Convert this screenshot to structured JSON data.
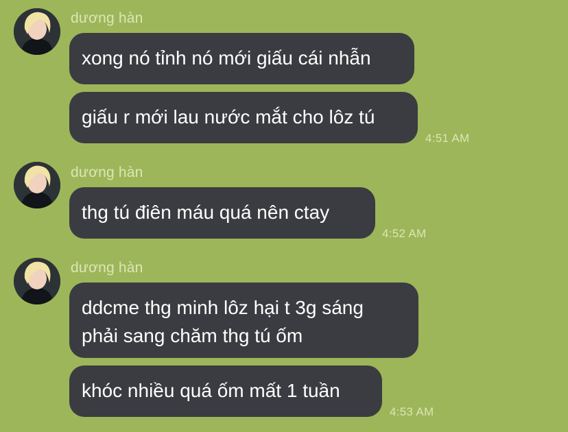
{
  "messages": [
    {
      "sender": "dương hàn",
      "bubbles": [
        "xong nó tỉnh nó mới giấu cái nhẫn",
        "giấu r mới lau nước mắt cho lôz tú"
      ],
      "time": "4:51 AM"
    },
    {
      "sender": "dương hàn",
      "bubbles": [
        "thg tú điên máu quá nên ctay"
      ],
      "time": "4:52 AM"
    },
    {
      "sender": "dương hàn",
      "bubbles": [
        "ddcme thg minh lôz hại t 3g sáng\nphải sang chăm thg tú ốm",
        "khóc nhiều quá ốm mất 1 tuần"
      ],
      "time": "4:53 AM"
    }
  ],
  "colors": {
    "background": "#9db65a",
    "bubble": "#3b3c41",
    "meta_text": "#dbe6b6"
  }
}
